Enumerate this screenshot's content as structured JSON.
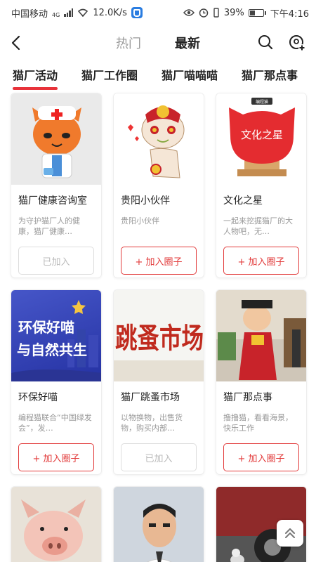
{
  "status": {
    "carrier": "中国移动",
    "net_type": "4G",
    "speed": "12.0K/s",
    "battery": "39%",
    "time": "下午4:16",
    "battery_level": 0.39
  },
  "nav": {
    "tabs": [
      {
        "label": "热门",
        "active": false
      },
      {
        "label": "最新",
        "active": true
      }
    ]
  },
  "categories": [
    {
      "label": "猫厂活动",
      "active": true
    },
    {
      "label": "猫厂工作圈",
      "active": false
    },
    {
      "label": "猫厂喵喵喵",
      "active": false
    },
    {
      "label": "猫厂那点事",
      "active": false
    }
  ],
  "cards": [
    {
      "title": "猫厂健康咨询室",
      "desc": "为守护猫厂人的健康，猫厂健康…",
      "button": "已加入",
      "joined": true,
      "image": "doctor-cat-mascot"
    },
    {
      "title": "贵阳小伙伴",
      "desc": "贵阳小伙伴",
      "button": "+ 加入圈子",
      "joined": false,
      "image": "cat-mascot-with-hat"
    },
    {
      "title": "文化之星",
      "desc": "一起来挖掘猫厂的大人物吧，无…",
      "button": "+ 加入圈子",
      "joined": false,
      "image": "culture-star-sign",
      "image_text": "文化之星",
      "image_brand": "编程猫"
    },
    {
      "title": "环保好喵",
      "desc": "编程猫联合“中国绿发会”，发…",
      "button": "+ 加入圈子",
      "joined": false,
      "image": "eco-poster",
      "image_text_1": "环保好喵",
      "image_text_2": "与自然共生"
    },
    {
      "title": "猫厂跳蚤市场",
      "desc": "以物换物，出售货物，购买内部…",
      "button": "已加入",
      "joined": true,
      "image": "flea-market-calligraphy",
      "image_text": "跳蚤市场"
    },
    {
      "title": "猫厂那点事",
      "desc": "撸撸猫，看看海景，快乐工作",
      "button": "+ 加入圈子",
      "joined": false,
      "image": "costume-mascot-photo"
    }
  ],
  "partial_cards": [
    {
      "image": "piglet-photo"
    },
    {
      "image": "man-portrait-photo"
    },
    {
      "image": "cat-under-car-photo"
    }
  ]
}
